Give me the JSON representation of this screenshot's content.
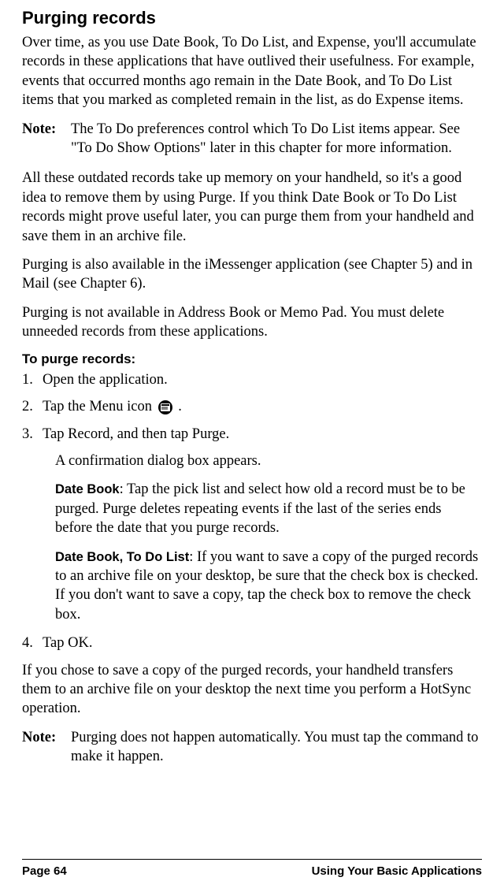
{
  "heading1": "Purging records",
  "para1": "Over time, as you use Date Book, To Do List, and Expense, you'll accumulate records in these applications that have outlived their usefulness. For example, events that occurred months ago remain in the Date Book, and To Do List items that you marked as completed remain in the list, as do Expense items.",
  "note1": {
    "label": "Note:",
    "text": "The To Do preferences control which To Do List items appear. See \"To Do Show Options\" later in this chapter for more information."
  },
  "para2": "All these outdated records take up memory on your handheld, so it's a good idea to remove them by using Purge. If you think Date Book or To Do List records might prove useful later, you can purge them from your handheld and save them in an archive file.",
  "para3": "Purging is also available in the iMessenger application (see Chapter 5) and in Mail (see Chapter 6).",
  "para4": "Purging is not available in Address Book or Memo Pad. You must delete unneeded records from these applications.",
  "heading2": "To purge records:",
  "steps": {
    "s1n": "1.",
    "s1t": "Open the application.",
    "s2n": "2.",
    "s2t_a": "Tap the Menu icon ",
    "s2t_b": " .",
    "s3n": "3.",
    "s3t": "Tap Record, and then tap Purge.",
    "s4n": "4.",
    "s4t": "Tap OK."
  },
  "indent1": "A confirmation dialog box appears.",
  "indent2": {
    "label": "Date Book",
    "text": ": Tap the pick list and select how old a record must be to be purged. Purge deletes repeating events if the last of the series ends before the date that you purge records."
  },
  "indent3": {
    "label": "Date Book, To Do List",
    "text": ": If you want to save a copy of the purged records to an archive file on your desktop, be sure that the check box is checked. If you don't want to save a copy, tap the check box to remove the check box."
  },
  "para5": "If you chose to save a copy of the purged records, your handheld transfers them to an archive file on your desktop the next time you perform a HotSync operation.",
  "note2": {
    "label": "Note:",
    "text": "Purging does not happen automatically. You must tap the command to make it happen."
  },
  "footer": {
    "left": "Page 64",
    "right": "Using Your Basic Applications"
  }
}
